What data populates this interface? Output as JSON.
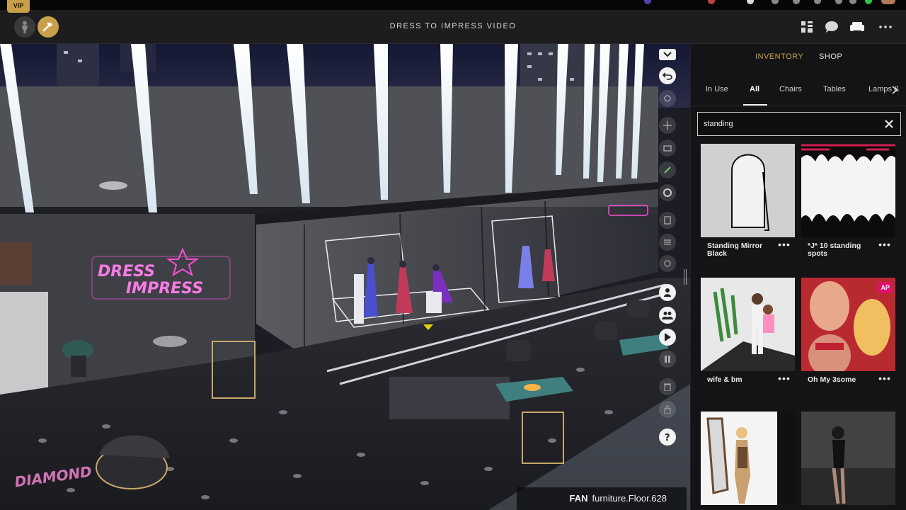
{
  "header": {
    "vip_badge": "VIP",
    "title": "DRESS TO IMPRESS VIDEO",
    "left_icons": [
      "avatar-icon",
      "hammer-icon"
    ],
    "right_icons": [
      "layout-icon",
      "chat-icon",
      "sofa-icon",
      "more-icon"
    ]
  },
  "scene": {
    "sign_line1": "DRESS",
    "sign_line2": "IMPRESS",
    "corner_logo": "DIAMOND",
    "status_prefix": "FAN",
    "status_object": "furniture.Floor.628",
    "toolbar": [
      "collapse-chevron-icon",
      "undo-icon",
      "rotate-icon",
      "move-icon",
      "camera-icon",
      "edit-icon",
      "spin-icon",
      "copy-icon",
      "stack-icon",
      "layers-icon",
      "person-icon",
      "group-icon",
      "play-icon",
      "pause-icon",
      "trash-icon",
      "lock-icon",
      "help-icon"
    ]
  },
  "inventory": {
    "tabs": [
      {
        "label": "INVENTORY",
        "active": true
      },
      {
        "label": "SHOP",
        "active": false
      }
    ],
    "categories": [
      {
        "label": "In Use",
        "active": false
      },
      {
        "label": "All",
        "active": true
      },
      {
        "label": "Chairs",
        "active": false
      },
      {
        "label": "Tables",
        "active": false
      },
      {
        "label": "Lamps &",
        "active": false
      }
    ],
    "search": {
      "value": "standing",
      "placeholder": "Search"
    },
    "items": [
      {
        "label": "Standing Mirror Black",
        "badge": ""
      },
      {
        "label": "*J* 10 standing spots",
        "badge": ""
      },
      {
        "label": "wife & bm",
        "badge": ""
      },
      {
        "label": "Oh My 3some",
        "badge": "AP"
      },
      {
        "label": "",
        "badge": ""
      },
      {
        "label": "",
        "badge": ""
      }
    ],
    "more_glyph": "•••"
  },
  "colors": {
    "accent_gold": "#c9a04a",
    "active_tab_gold": "#c9a04a",
    "panel_bg": "#141416",
    "header_bg": "#1d1d1f",
    "neon_pink": "#ff4fd8",
    "ap_badge": "#e0106a"
  }
}
